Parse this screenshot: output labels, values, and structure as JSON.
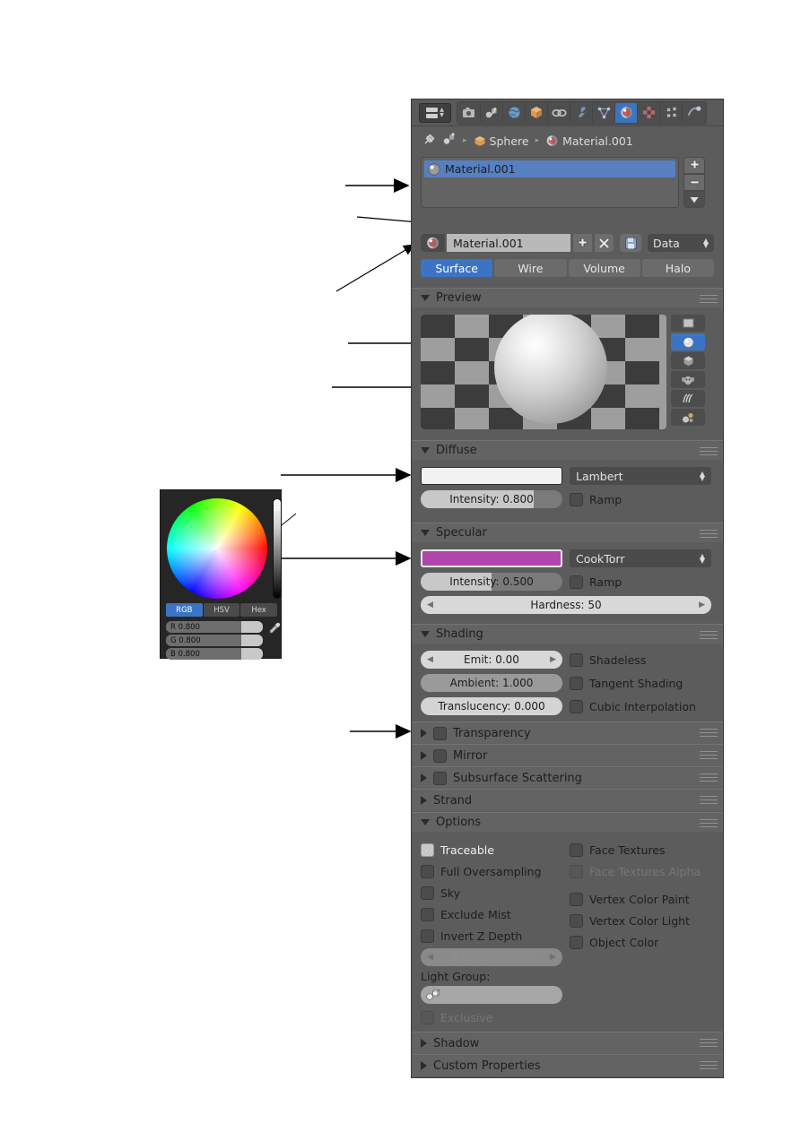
{
  "window": {
    "editor": "Properties",
    "editor_type_icon": "editor-type-selector"
  },
  "header": {
    "tabs": [
      {
        "name": "render",
        "icon": "camera-icon",
        "active": false
      },
      {
        "name": "scene",
        "icon": "scene-icon",
        "active": false
      },
      {
        "name": "world",
        "icon": "globe-icon",
        "active": false
      },
      {
        "name": "object",
        "icon": "cube-icon",
        "active": false
      },
      {
        "name": "constraints",
        "icon": "chain-icon",
        "active": false
      },
      {
        "name": "modifiers",
        "icon": "wrench-icon",
        "active": false
      },
      {
        "name": "data",
        "icon": "triangle-mesh-icon",
        "active": false
      },
      {
        "name": "material",
        "icon": "material-sphere-icon",
        "active": true
      },
      {
        "name": "texture",
        "icon": "checker-icon",
        "active": false
      },
      {
        "name": "particles",
        "icon": "particles-icon",
        "active": false
      },
      {
        "name": "physics",
        "icon": "physics-orbit-icon",
        "active": false
      }
    ]
  },
  "breadcrumb": {
    "pin_icon": "pin-icon",
    "scene_icon": "scene-icon",
    "object": "Sphere",
    "object_icon": "object-cube-icon",
    "material": "Material.001",
    "material_icon": "material-sphere-icon",
    "separator": "▸"
  },
  "slots": {
    "items": [
      {
        "label": "Material.001",
        "icon": "material-ball-icon",
        "selected": true
      }
    ],
    "add_label": "+",
    "remove_label": "−",
    "menu_label": "▼"
  },
  "datablock": {
    "icon": "material-ball-icon",
    "name": "Material.001",
    "new_label": "+",
    "unlink_label": "✕",
    "fake_user_icon": "save-fake-user-icon",
    "dropdown": "Data"
  },
  "surface_tabs": [
    {
      "label": "Surface",
      "active": true
    },
    {
      "label": "Wire",
      "active": false
    },
    {
      "label": "Volume",
      "active": false
    },
    {
      "label": "Halo",
      "active": false
    }
  ],
  "preview": {
    "title": "Preview",
    "type_buttons": [
      {
        "name": "preview-flat",
        "icon": "plane-icon",
        "active": false
      },
      {
        "name": "preview-sphere",
        "icon": "sphere-icon",
        "active": true
      },
      {
        "name": "preview-cube",
        "icon": "cube-icon",
        "active": false
      },
      {
        "name": "preview-monkey",
        "icon": "monkey-icon",
        "active": false
      },
      {
        "name": "preview-hair",
        "icon": "hair-strands-icon",
        "active": false
      },
      {
        "name": "preview-sss",
        "icon": "sss-balls-icon",
        "active": false
      }
    ]
  },
  "diffuse": {
    "title": "Diffuse",
    "color": "#f2f2f2",
    "shader": "Lambert",
    "intensity_label": "Intensity: 0.800",
    "intensity_value": 0.8,
    "ramp_label": "Ramp",
    "ramp_checked": false
  },
  "specular": {
    "title": "Specular",
    "color": "#b046ab",
    "shader": "CookTorr",
    "intensity_label": "Intensity: 0.500",
    "intensity_value": 0.5,
    "ramp_label": "Ramp",
    "ramp_checked": false,
    "hardness_label": "Hardness: 50"
  },
  "shading": {
    "title": "Shading",
    "emit_label": "Emit: 0.00",
    "ambient_label": "Ambient: 1.000",
    "translucency_label": "Translucency: 0.000",
    "checkboxes": [
      {
        "label": "Shadeless",
        "checked": false
      },
      {
        "label": "Tangent Shading",
        "checked": false
      },
      {
        "label": "Cubic Interpolation",
        "checked": false
      }
    ]
  },
  "collapsed_panels": [
    {
      "label": "Transparency",
      "has_checkbox": true,
      "checked": false
    },
    {
      "label": "Mirror",
      "has_checkbox": true,
      "checked": false
    },
    {
      "label": "Subsurface Scattering",
      "has_checkbox": true,
      "checked": false
    },
    {
      "label": "Strand",
      "has_checkbox": false,
      "checked": false
    }
  ],
  "options": {
    "title": "Options",
    "left": [
      {
        "label": "Traceable",
        "checked": true,
        "disabled": false
      },
      {
        "label": "Full Oversampling",
        "checked": false,
        "disabled": false
      },
      {
        "label": "Sky",
        "checked": false,
        "disabled": false
      },
      {
        "label": "Exclude Mist",
        "checked": false,
        "disabled": false
      },
      {
        "label": "Invert Z Depth",
        "checked": false,
        "disabled": false
      }
    ],
    "z_offset_label": "Z Offset: 0.000",
    "right": [
      {
        "label": "Face Textures",
        "checked": false,
        "disabled": false
      },
      {
        "label": "Face Textures Alpha",
        "checked": false,
        "disabled": true
      },
      {
        "label": "Vertex Color Paint",
        "checked": false,
        "disabled": false
      },
      {
        "label": "Vertex Color Light",
        "checked": false,
        "disabled": false
      },
      {
        "label": "Object Color",
        "checked": false,
        "disabled": false
      }
    ],
    "light_group_label": "Light Group:",
    "light_group_value": "",
    "light_group_icon": "group-icon",
    "exclusive_label": "Exclusive",
    "exclusive_checked": false,
    "exclusive_disabled": true
  },
  "bottom_panels": [
    {
      "label": "Shadow"
    },
    {
      "label": "Custom Properties"
    }
  ],
  "color_picker": {
    "wheel_name": "color-wheel",
    "value_slider_name": "value-slider",
    "modes": [
      {
        "label": "RGB",
        "active": true
      },
      {
        "label": "HSV",
        "active": false
      },
      {
        "label": "Hex",
        "active": false
      }
    ],
    "channels": [
      {
        "label": "R 0.800",
        "value": 0.8
      },
      {
        "label": "G 0.800",
        "value": 0.8
      },
      {
        "label": "B 0.800",
        "value": 0.8
      }
    ],
    "eyedropper_icon": "eyedropper-icon"
  },
  "colors": {
    "accent_blue": "#3b74c4",
    "slot_select_blue": "#5680c2",
    "panel_bg": "#5c5c5c",
    "header_bg": "#5a5a5a",
    "specular": "#b046ab"
  }
}
